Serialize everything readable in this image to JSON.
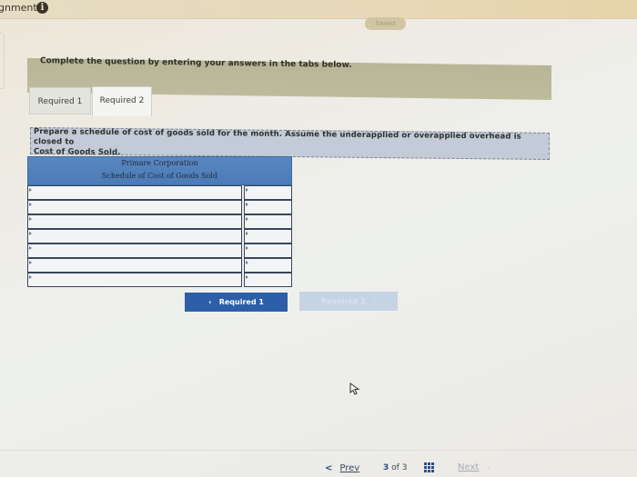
{
  "header": {
    "title": "gnment",
    "info_icon": "info-icon",
    "saved_label": "Saved"
  },
  "instruction": "Complete the question by entering your answers in the tabs below.",
  "tabs": [
    {
      "label": "Required 1",
      "active": false
    },
    {
      "label": "Required 2",
      "active": true
    }
  ],
  "prompt": {
    "line1": "Prepare a schedule of cost of goods sold for the month. Assume the underapplied or overapplied overhead is closed to",
    "line2": "Cost of Goods Sold."
  },
  "schedule": {
    "company": "Primare Corporation",
    "title": "Schedule of Cost of Goods Sold",
    "rows": [
      {
        "label": "",
        "amount": ""
      },
      {
        "label": "",
        "amount": ""
      },
      {
        "label": "",
        "amount": ""
      },
      {
        "label": "",
        "amount": ""
      },
      {
        "label": "",
        "amount": ""
      },
      {
        "label": "",
        "amount": ""
      },
      {
        "label": "",
        "amount": ""
      }
    ]
  },
  "nav_buttons": {
    "prev_required": "Required 1",
    "next_required": "Required 2",
    "prev_chevron": "‹",
    "next_chevron": "›"
  },
  "footer": {
    "prev_label": "Prev",
    "current_page": "3",
    "of_label": "of",
    "total_pages": "3",
    "next_label": "Next"
  }
}
